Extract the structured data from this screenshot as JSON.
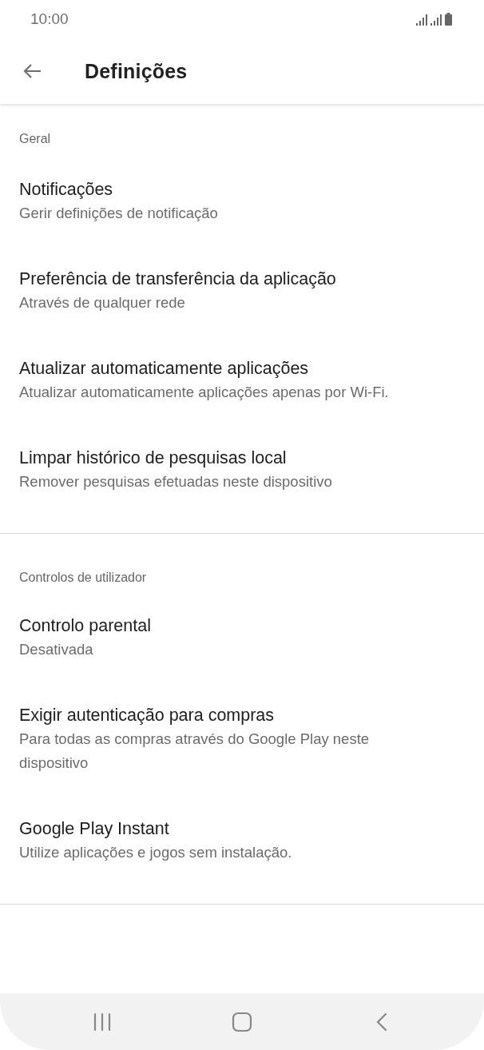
{
  "status_bar": {
    "time": "10:00"
  },
  "app_bar": {
    "title": "Definições"
  },
  "sections": [
    {
      "header": "Geral",
      "items": [
        {
          "title": "Notificações",
          "subtitle": "Gerir definições de notificação"
        },
        {
          "title": "Preferência de transferência da aplicação",
          "subtitle": "Através de qualquer rede"
        },
        {
          "title": "Atualizar automaticamente aplicações",
          "subtitle": "Atualizar automaticamente aplicações apenas por Wi-Fi."
        },
        {
          "title": "Limpar histórico de pesquisas local",
          "subtitle": "Remover pesquisas efetuadas neste dispositivo"
        }
      ]
    },
    {
      "header": "Controlos de utilizador",
      "items": [
        {
          "title": "Controlo parental",
          "subtitle": "Desativada"
        },
        {
          "title": "Exigir autenticação para compras",
          "subtitle": "Para todas as compras através do Google Play neste dispositivo"
        },
        {
          "title": "Google Play Instant",
          "subtitle": "Utilize aplicações e jogos sem instalação."
        }
      ]
    }
  ]
}
